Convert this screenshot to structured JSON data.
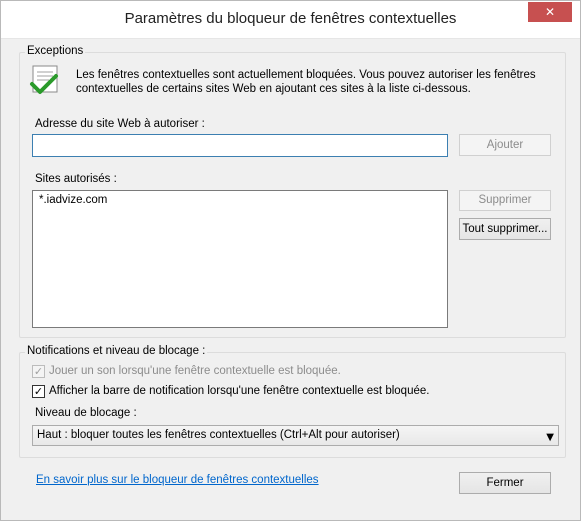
{
  "window": {
    "title": "Paramètres du bloqueur de fenêtres contextuelles",
    "close_glyph": "✕"
  },
  "exceptions": {
    "legend": "Exceptions",
    "icon": "green-check-icon",
    "description_line1": "Les fenêtres contextuelles sont actuellement bloquées.  Vous pouvez autoriser les fenêtres",
    "description_line2": "contextuelles de certains sites Web en ajoutant ces sites à la liste ci-dessous.",
    "address_label": "Adresse du site Web à autoriser :",
    "address_value": "",
    "add_button": "Ajouter",
    "allowed_label": "Sites autorisés :",
    "allowed_sites": [
      "*.iadvize.com"
    ],
    "remove_button": "Supprimer",
    "remove_all_button": "Tout supprimer..."
  },
  "notifications": {
    "legend": "Notifications et niveau de blocage :",
    "play_sound_label": "Jouer un son lorsqu'une fenêtre contextuelle est bloquée.",
    "play_sound_checked": true,
    "show_bar_label": "Afficher la barre de notification lorsqu'une fenêtre contextuelle est bloquée.",
    "show_bar_checked": true,
    "level_label": "Niveau de blocage :",
    "level_value": "Haut : bloquer toutes les fenêtres contextuelles (Ctrl+Alt pour autoriser)"
  },
  "footer": {
    "learn_more_link": "En savoir plus sur le bloqueur de fenêtres contextuelles",
    "close_button": "Fermer"
  },
  "colors": {
    "close_red": "#c75050",
    "link_blue": "#0066cc",
    "focus_border": "#3c7fb1"
  }
}
